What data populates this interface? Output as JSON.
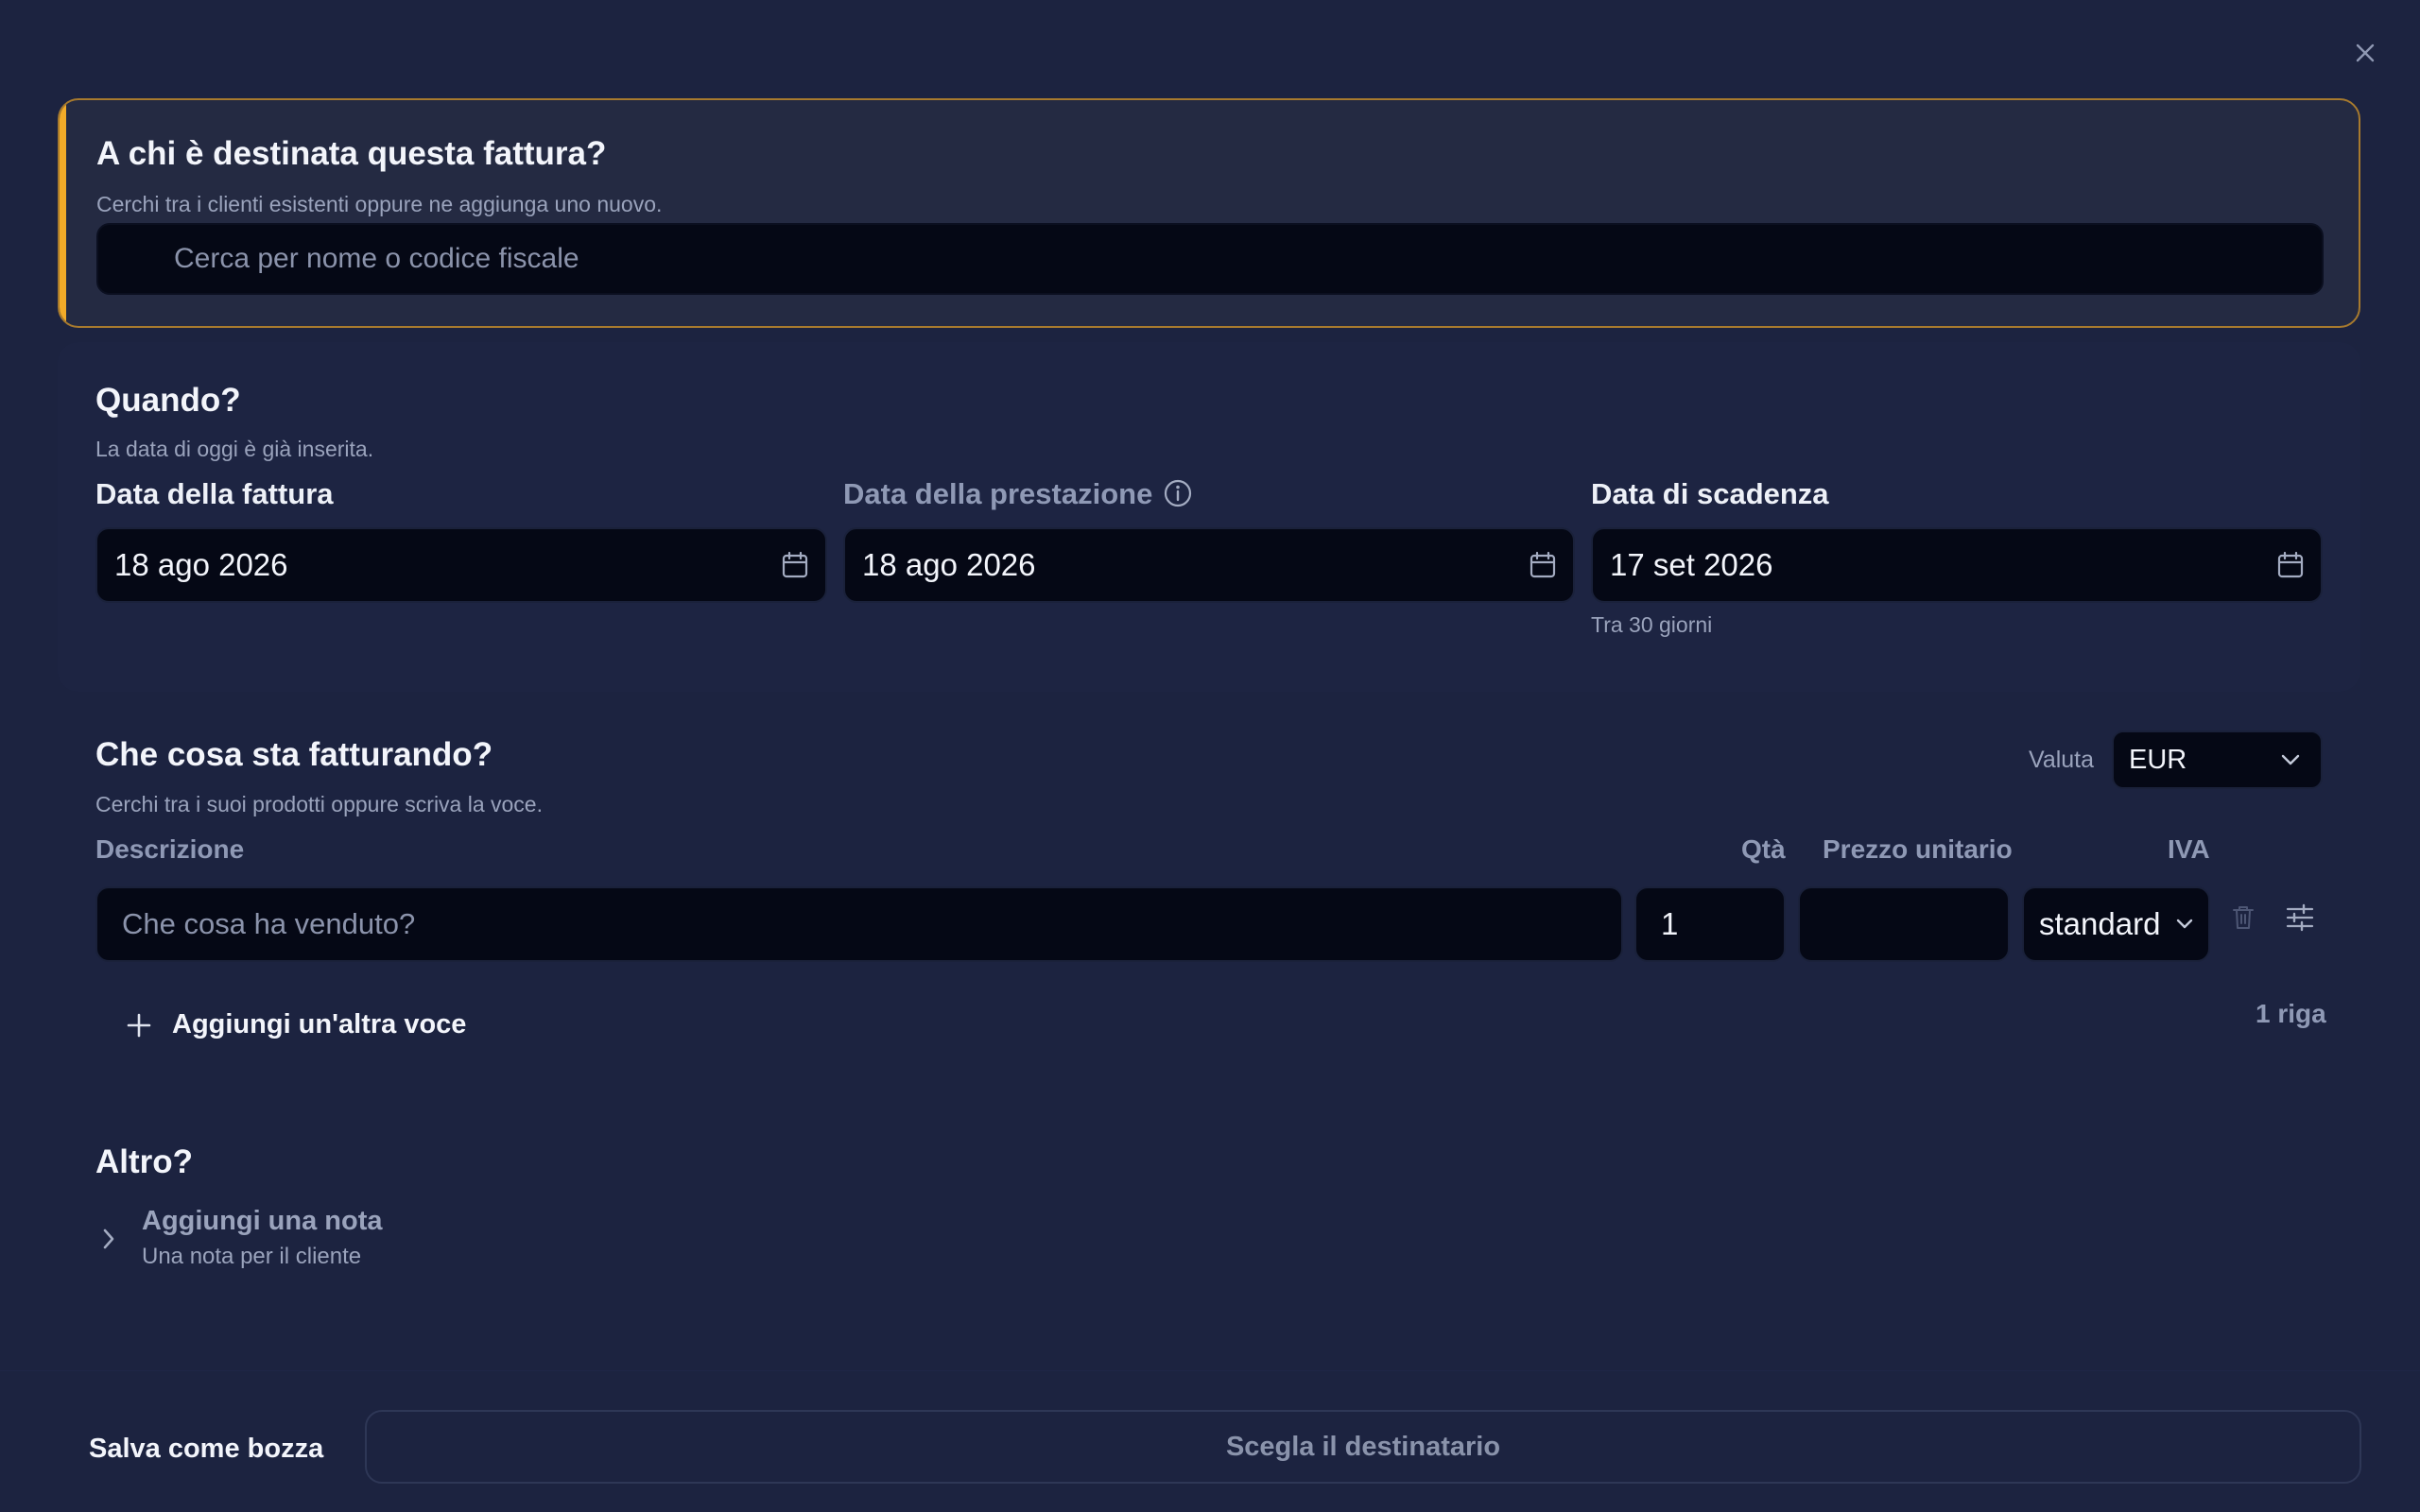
{
  "recipient": {
    "title": "A chi è destinata questa fattura?",
    "subtitle": "Cerchi tra i clienti esistenti oppure ne aggiunga uno nuovo.",
    "search_placeholder": "Cerca per nome o codice fiscale",
    "accent_color": "#f2ab28"
  },
  "when": {
    "title": "Quando?",
    "subtitle": "La data di oggi è già inserita.",
    "invoice_date_label": "Data della fattura",
    "invoice_date_value": "18 ago 2026",
    "service_date_label": "Data della prestazione",
    "service_date_value": "18 ago 2026",
    "due_date_label": "Data di scadenza",
    "due_date_value": "17 set 2026",
    "due_hint": "Tra 30 giorni"
  },
  "items": {
    "title": "Che cosa sta fatturando?",
    "subtitle": "Cerchi tra i suoi prodotti oppure scriva la voce.",
    "currency_label": "Valuta",
    "currency_value": "EUR",
    "col_description": "Descrizione",
    "col_qty": "Qtà",
    "col_unit_price": "Prezzo unitario",
    "col_vat": "IVA",
    "row": {
      "description_placeholder": "Che cosa ha venduto?",
      "qty": "1",
      "unit_price": "",
      "vat": "standard"
    },
    "add_label": "Aggiungi un'altra voce",
    "row_count": "1 riga"
  },
  "other": {
    "title": "Altro?",
    "note_title": "Aggiungi una nota",
    "note_subtitle": "Una nota per il cliente"
  },
  "footer": {
    "save_draft": "Salva come bozza",
    "primary": "Scegla il destinatario"
  }
}
